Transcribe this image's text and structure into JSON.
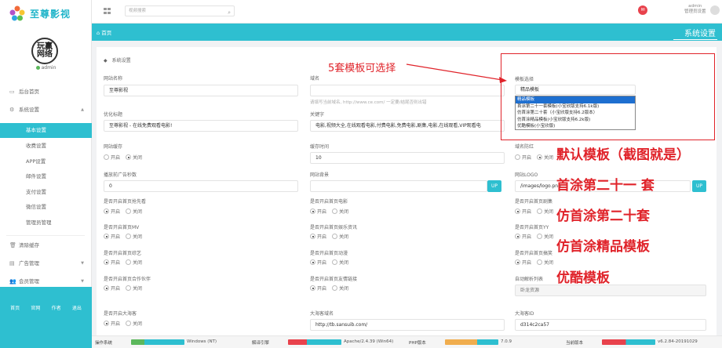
{
  "app": {
    "logo_text": "至尊影视"
  },
  "user": {
    "avatar_text": "玩赢\n网络",
    "name": "admin",
    "header_name": "admin",
    "header_role": "管理员设置"
  },
  "search": {
    "placeholder": "视频搜索"
  },
  "sidebar": {
    "items": [
      {
        "label": "后台首页",
        "icon": "monitor-icon"
      },
      {
        "label": "系统设置",
        "icon": "settings-icon"
      }
    ],
    "sub_items": [
      "基本设置",
      "收费设置",
      "APP设置",
      "邮件设置",
      "支付设置",
      "微信设置",
      "管理员管理"
    ],
    "bottom_items": [
      {
        "label": "清除缓存",
        "icon": "trash-icon"
      },
      {
        "label": "广告管理",
        "icon": "ad-icon"
      },
      {
        "label": "会员管理",
        "icon": "users-icon"
      }
    ],
    "footer_links": [
      "首页",
      "官网",
      "作者",
      "退出"
    ]
  },
  "tabbar": {
    "home": "首页",
    "title": "系统设置"
  },
  "panel": {
    "title": "系统设置"
  },
  "form": {
    "site_name": {
      "label": "网站名称",
      "value": "至尊影视"
    },
    "domain": {
      "label": "域名",
      "value": "",
      "hint": "请填写当前域名, http://www.ce.com/ 一定要/结尾否则出错"
    },
    "template": {
      "label": "模板选择",
      "value": "精品模板"
    },
    "seo_title": {
      "label": "优化标题",
      "value": "至尊影视 - 在线免费观看电影!"
    },
    "keywords": {
      "label": "关键字",
      "value": "电影,视频大全,在线观看电影,付费电影,免费电影,剧集,电影,在线观看,VIP观看电"
    },
    "cache": {
      "label": "网站缓存",
      "options": [
        "开启",
        "关闭"
      ],
      "selected": 1
    },
    "cache_time": {
      "label": "缓存时间",
      "value": "10"
    },
    "anti_red": {
      "label": "域名防红",
      "options": [
        "开启",
        "关闭"
      ],
      "selected": 1
    },
    "ad_seconds": {
      "label": "播放前广告秒数",
      "value": "0"
    },
    "background": {
      "label": "网站背景",
      "value": "",
      "button": "UP"
    },
    "site_logo": {
      "label": "网站LOGO",
      "value": "/images/logo.png",
      "button": "UP"
    },
    "row_toggles": [
      [
        {
          "label": "是否开启首页抢先看",
          "options": [
            "开启",
            "关闭"
          ],
          "selected": 0
        },
        {
          "label": "是否开启首页电影",
          "options": [
            "开启",
            "关闭"
          ],
          "selected": 0
        },
        {
          "label": "是否开启首页剧集",
          "options": [
            "开启",
            "关闭"
          ],
          "selected": 0
        }
      ],
      [
        {
          "label": "是否开启首页MV",
          "options": [
            "开启",
            "关闭"
          ],
          "selected": 0
        },
        {
          "label": "是否开启首页娱乐资讯",
          "options": [
            "开启",
            "关闭"
          ],
          "selected": 0
        },
        {
          "label": "是否开启首页YY",
          "options": [
            "开启",
            "关闭"
          ],
          "selected": 0
        }
      ],
      [
        {
          "label": "是否开启首页综艺",
          "options": [
            "开启",
            "关闭"
          ],
          "selected": 0
        },
        {
          "label": "是否开启首页动漫",
          "options": [
            "开启",
            "关闭"
          ],
          "selected": 0
        },
        {
          "label": "是否开启首页搞笑",
          "options": [
            "开启",
            "关闭"
          ],
          "selected": 0
        }
      ],
      [
        {
          "label": "是否开启首页合作伙伴",
          "options": [
            "开启",
            "关闭"
          ],
          "selected": 0
        },
        {
          "label": "是否开启首页友情链接",
          "options": [
            "开启",
            "关闭"
          ],
          "selected": 0
        }
      ]
    ],
    "auto_parse": {
      "label": "自动解析列表",
      "value": "卧龙资源"
    },
    "dht_toggle": {
      "label": "是否开启大海客",
      "options": [
        "开启",
        "关闭"
      ],
      "selected": 0
    },
    "dht_domain": {
      "label": "大海客域名",
      "value": "http://tb.sansuib.com/"
    },
    "dht_id": {
      "label": "大海客ID",
      "value": "d314c2ca57"
    }
  },
  "template_options": [
    "精品模板",
    "首涂第二十一套模板(小宝欣版支持6.1k版)",
    "仿首涂第二十套（小宝欣版支持6.2版本）",
    "仿首涂精品模板(小宝欣版支持6.2k版)",
    "优酷模板(小宝欣版)"
  ],
  "annotations": {
    "title": "5套模板可选择",
    "items": [
      "默认模板（截图就是）",
      "首涂第二十一 套",
      "仿首涂第二十套",
      "仿首涂精品模板",
      "优酷模板"
    ]
  },
  "statusbar": [
    {
      "label": "操作系统",
      "value": "Windows (NT)"
    },
    {
      "label": "解译引擎",
      "value": "Apache/2.4.39 (Win64)"
    },
    {
      "label": "PHP版本",
      "value": "7.0.9"
    },
    {
      "label": "当前版本",
      "value": "v6.2.84-20191029"
    }
  ],
  "colors": {
    "accent": "#2ebfd0",
    "annotation": "#e0232a"
  }
}
